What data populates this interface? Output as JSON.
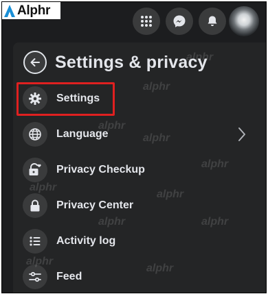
{
  "brand": {
    "logo_text": "Alphr"
  },
  "watermark": "alphr",
  "topbar": {
    "buttons": [
      {
        "name": "menu-grid-button",
        "icon": "grid-icon"
      },
      {
        "name": "messenger-button",
        "icon": "messenger-icon"
      },
      {
        "name": "notifications-button",
        "icon": "bell-icon"
      },
      {
        "name": "account-avatar",
        "icon": "avatar"
      }
    ]
  },
  "panel": {
    "title": "Settings & privacy",
    "back_icon": "arrow-left-icon",
    "items": [
      {
        "label": "Settings",
        "icon": "gear-icon",
        "highlighted": true
      },
      {
        "label": "Language",
        "icon": "globe-icon",
        "has_submenu": true
      },
      {
        "label": "Privacy Checkup",
        "icon": "lock-heart-icon"
      },
      {
        "label": "Privacy Center",
        "icon": "lock-icon"
      },
      {
        "label": "Activity log",
        "icon": "list-icon"
      },
      {
        "label": "Feed",
        "icon": "sliders-icon"
      }
    ]
  },
  "colors": {
    "background": "#1c1d1f",
    "panel": "#242526",
    "button": "#3a3b3c",
    "text": "#e4e6eb",
    "highlight": "#e02020"
  }
}
